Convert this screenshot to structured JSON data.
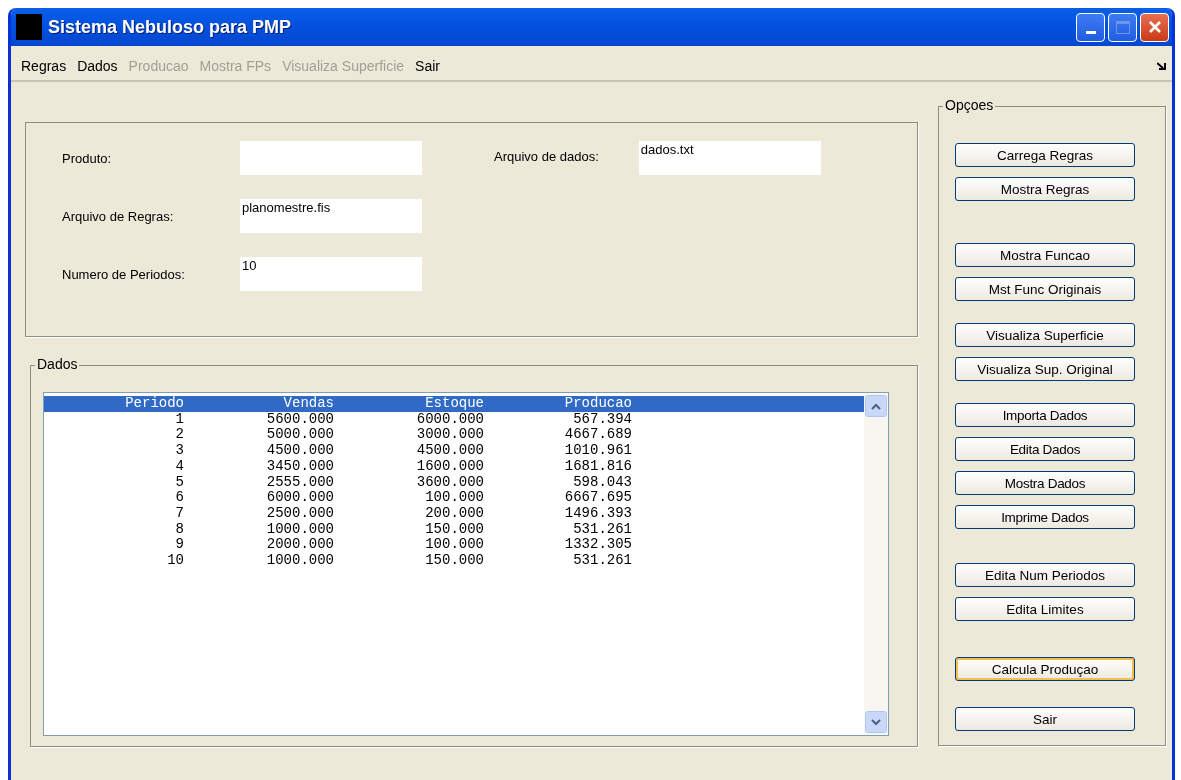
{
  "window": {
    "title": "Sistema Nebuloso para PMP"
  },
  "menu": [
    {
      "label": "Regras",
      "disabled": false
    },
    {
      "label": "Dados",
      "disabled": false
    },
    {
      "label": "Producao",
      "disabled": true
    },
    {
      "label": "Mostra FPs",
      "disabled": true
    },
    {
      "label": "Visualiza Superficie",
      "disabled": true
    },
    {
      "label": "Sair",
      "disabled": false
    }
  ],
  "form": {
    "fields": [
      {
        "label": "Produto:"
      },
      {
        "label": "Arquivo de Regras:",
        "value": "planomestre.fis"
      },
      {
        "label": "Numero de Periodos:",
        "value": "10"
      }
    ],
    "side_field": {
      "label": "Arquivo de dados:",
      "value": "dados.txt"
    }
  },
  "data_panel": {
    "title": "Dados",
    "rows": [
      {
        "cells": [
          "Periodo",
          "Vendas",
          "Estoque",
          "Producao"
        ],
        "selected": true
      },
      {
        "cells": [
          "1",
          "5600.000",
          "6000.000",
          "567.394"
        ],
        "selected": false
      },
      {
        "cells": [
          "2",
          "5000.000",
          "3000.000",
          "4667.689"
        ],
        "selected": false
      },
      {
        "cells": [
          "3",
          "4500.000",
          "4500.000",
          "1010.961"
        ],
        "selected": false
      },
      {
        "cells": [
          "4",
          "3450.000",
          "1600.000",
          "1681.816"
        ],
        "selected": false
      },
      {
        "cells": [
          "5",
          "2555.000",
          "3600.000",
          "598.043"
        ],
        "selected": false
      },
      {
        "cells": [
          "6",
          "6000.000",
          "100.000",
          "6667.695"
        ],
        "selected": false
      },
      {
        "cells": [
          "7",
          "2500.000",
          "200.000",
          "1496.393"
        ],
        "selected": false
      },
      {
        "cells": [
          "8",
          "1000.000",
          "150.000",
          "531.261"
        ],
        "selected": false
      },
      {
        "cells": [
          "9",
          "2000.000",
          "100.000",
          "1332.305"
        ],
        "selected": false
      },
      {
        "cells": [
          "10",
          "1000.000",
          "150.000",
          "531.261"
        ],
        "selected": false
      }
    ]
  },
  "options": {
    "title": "Opçoes",
    "groups": [
      [
        {
          "label": "Carrega Regras",
          "focused": false
        },
        {
          "label": "Mostra Regras",
          "focused": false
        }
      ],
      [
        {
          "label": "Mostra Funcao",
          "focused": false
        },
        {
          "label": "Mst Func Originais",
          "focused": false
        }
      ],
      [
        {
          "label": "Visualiza Superficie",
          "focused": false
        },
        {
          "label": "Visualiza Sup. Original",
          "focused": false
        }
      ],
      [
        {
          "label": "Importa Dados",
          "focused": false
        },
        {
          "label": "Edita Dados",
          "focused": false
        },
        {
          "label": "Mostra Dados",
          "focused": false
        },
        {
          "label": "Imprime Dados",
          "focused": false
        }
      ],
      [
        {
          "label": "Edita Num Periodos",
          "focused": false
        },
        {
          "label": "Edita Limites",
          "focused": false
        }
      ],
      [
        {
          "label": "Calcula Produçao",
          "focused": true
        }
      ],
      [
        {
          "label": "Sair",
          "focused": false
        }
      ]
    ]
  }
}
